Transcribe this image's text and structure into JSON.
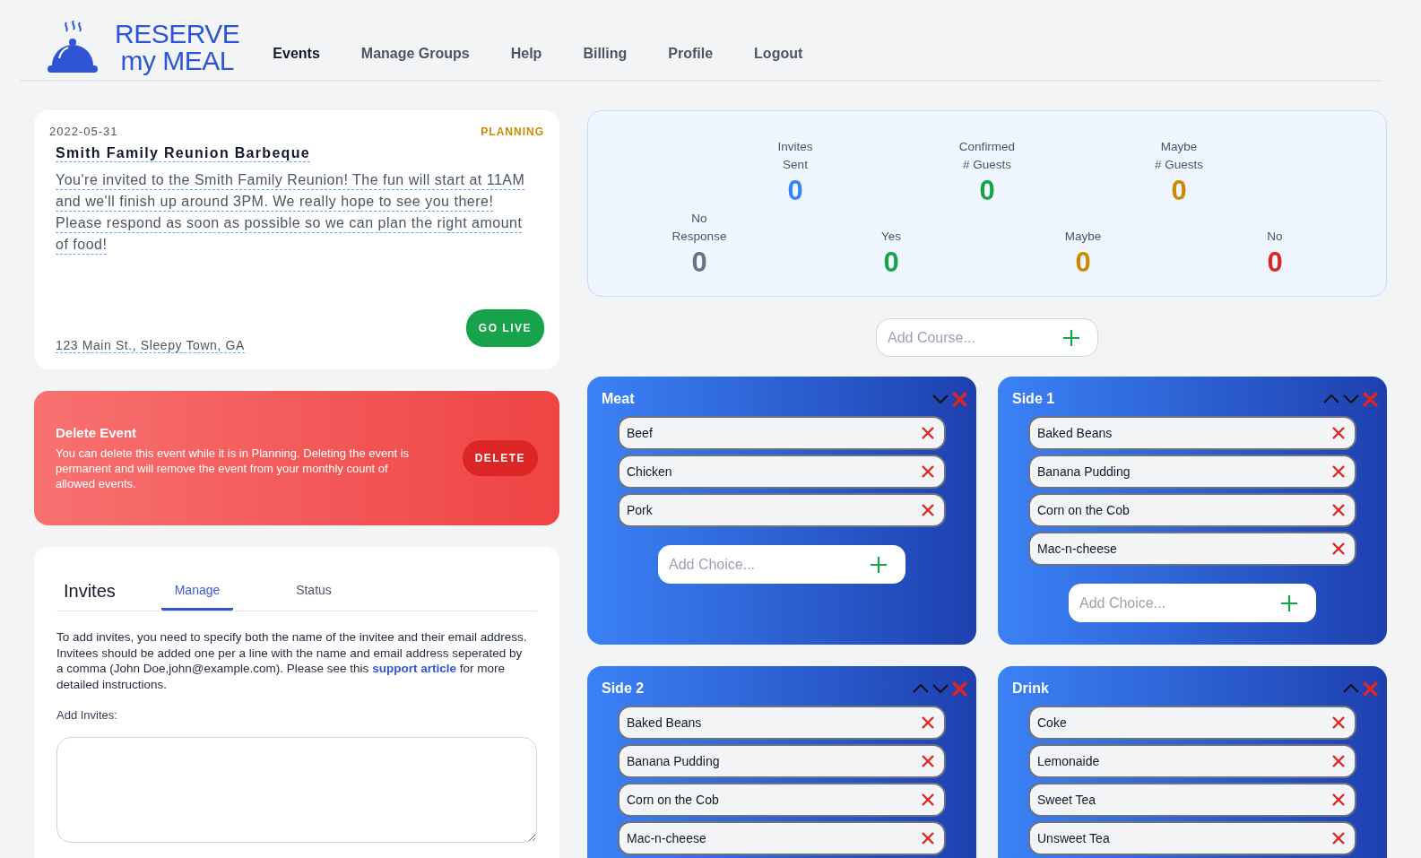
{
  "logo": {
    "line_1": "RESERVE",
    "line_2": "my MEAL"
  },
  "nav": [
    {
      "label": "Events",
      "selected": true
    },
    {
      "label": "Manage Groups",
      "selected": false
    },
    {
      "label": "Help",
      "selected": false
    },
    {
      "label": "Billing",
      "selected": false
    },
    {
      "label": "Profile",
      "selected": false
    },
    {
      "label": "Logout",
      "selected": false
    }
  ],
  "event": {
    "date": "2022-05-31",
    "status": "PLANNING",
    "title": "Smith Family Reunion Barbeque",
    "description": "You're invited to the Smith Family Reunion! The fun will start at 11AM and we'll finish up around 3PM. We really hope to see you there! Please respond as soon as possible so we can plan the right amount of food!",
    "address": "123 Main St., Sleepy Town, GA",
    "button": "GO LIVE"
  },
  "delete_panel": {
    "title": "Delete Event",
    "text": "You can delete this event while it is in Planning. Deleting the event is permanent and will remove the event from your monthly count of allowed events.",
    "button": "DELETE"
  },
  "invites": {
    "title": "Invites",
    "tabs": [
      {
        "label": "Manage",
        "selected": true
      },
      {
        "label": "Status",
        "selected": false
      }
    ],
    "text_before": "To add invites, you need to specify both the name of the invitee and their email address. Invitees should be added one per a line with the name and email address seperated by a comma (John Doe,john@example.com). Please see this",
    "link": "support article",
    "text_after": "for more detailed instructions.",
    "field_label": "Add Invites:"
  },
  "stats_top": [
    {
      "label": "Invites",
      "label_2": "Sent",
      "value": "0",
      "color": "#3b82f6"
    },
    {
      "label": "Confirmed",
      "label_2": "# Guests",
      "value": "0",
      "color": "#16a34a"
    },
    {
      "label": "Maybe",
      "label_2": "# Guests",
      "value": "0",
      "color": "#ca8a04"
    }
  ],
  "stats_bottom": [
    {
      "label": "No",
      "label_2": "Response",
      "value": "0",
      "color": "#6b7280"
    },
    {
      "label": "Yes",
      "value": "0",
      "color": "#16a34a"
    },
    {
      "label": "Maybe",
      "value": "0",
      "color": "#ca8a04"
    },
    {
      "label": "No",
      "value": "0",
      "color": "#dc2626"
    }
  ],
  "add_course": {
    "placeholder": "Add Course..."
  },
  "courses": [
    {
      "title": "Meat",
      "move_up": false,
      "move_down": true,
      "choices": [
        "Beef",
        "Chicken",
        "Pork"
      ],
      "add_placeholder": "Add Choice..."
    },
    {
      "title": "Side 1",
      "move_up": true,
      "move_down": true,
      "choices": [
        "Baked Beans",
        "Banana Pudding",
        "Corn on the Cob",
        "Mac-n-cheese"
      ],
      "add_placeholder": "Add Choice..."
    },
    {
      "title": "Side 2",
      "move_up": true,
      "move_down": true,
      "choices": [
        "Baked Beans",
        "Banana Pudding",
        "Corn on the Cob",
        "Mac-n-cheese"
      ]
    },
    {
      "title": "Drink",
      "move_up": true,
      "move_down": false,
      "choices": [
        "Coke",
        "Lemonaide",
        "Sweet Tea",
        "Unsweet Tea"
      ]
    }
  ]
}
